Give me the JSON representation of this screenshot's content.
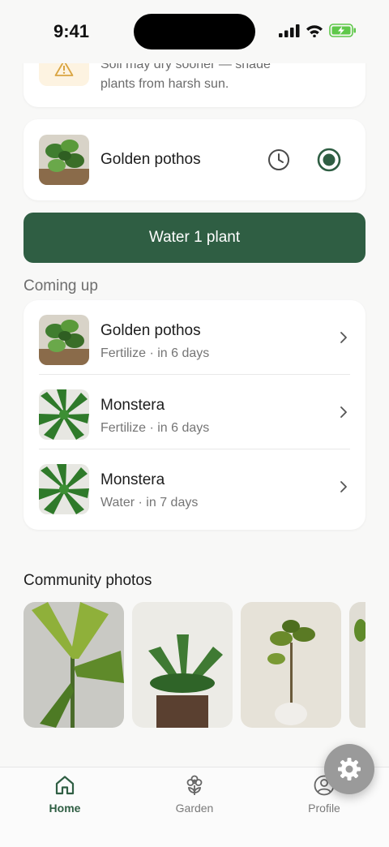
{
  "status_bar": {
    "time": "9:41"
  },
  "alert": {
    "text": "Soil may dry sooner — shade plants from harsh sun.",
    "icon": "warning-icon"
  },
  "task": {
    "plant_name": "Golden pothos"
  },
  "water_button": {
    "label": "Water 1 plant"
  },
  "coming_up": {
    "title": "Coming up",
    "items": [
      {
        "name": "Golden pothos",
        "detail": "Fertilize · in 6 days"
      },
      {
        "name": "Monstera",
        "detail": "Fertilize · in 6 days"
      },
      {
        "name": "Monstera",
        "detail": "Water · in 7 days"
      }
    ]
  },
  "community": {
    "title": "Community photos"
  },
  "tab_bar": {
    "tabs": [
      {
        "label": "Home",
        "icon": "home-icon",
        "active": true
      },
      {
        "label": "Garden",
        "icon": "flower-icon",
        "active": false
      },
      {
        "label": "Profile",
        "icon": "profile-icon",
        "active": false
      }
    ]
  },
  "colors": {
    "accent": "#2f5e43",
    "background": "#f8f8f7",
    "alert_bg": "#fdf3e1"
  }
}
